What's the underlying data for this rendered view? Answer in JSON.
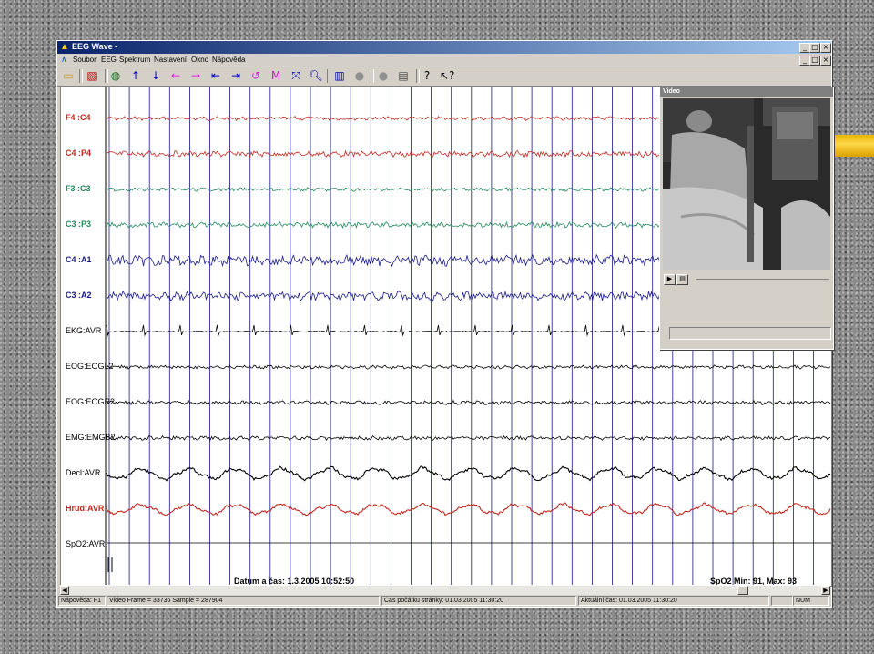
{
  "window": {
    "title": "EEG Wave -",
    "controls": [
      "_",
      "□",
      "×"
    ],
    "mdi_controls": [
      "_",
      "□",
      "×"
    ]
  },
  "menu": [
    "Soubor",
    "EEG",
    "Spektrum",
    "Nastavení",
    "Okno",
    "Nápověda"
  ],
  "toolbar_icons": [
    {
      "name": "open-icon",
      "glyph": "▭",
      "color": "#c89b2c"
    },
    {
      "name": "montage-icon",
      "glyph": "▧",
      "color": "#c00000"
    },
    {
      "name": "filter-icon",
      "glyph": "◍",
      "color": "#207020"
    },
    {
      "name": "arrow-up-icon",
      "glyph": "↑",
      "color": "#0000c0"
    },
    {
      "name": "arrow-down-icon",
      "glyph": "↓",
      "color": "#0000c0"
    },
    {
      "name": "arrow-left-icon",
      "glyph": "←",
      "color": "#e020e0"
    },
    {
      "name": "arrow-right-icon",
      "glyph": "→",
      "color": "#e020e0"
    },
    {
      "name": "first-page-icon",
      "glyph": "⇤",
      "color": "#0000c0"
    },
    {
      "name": "last-page-icon",
      "glyph": "⇥",
      "color": "#0000c0"
    },
    {
      "name": "loop-icon",
      "glyph": "↺",
      "color": "#e020e0"
    },
    {
      "name": "marker-icon",
      "glyph": "M",
      "color": "#c020c0"
    },
    {
      "name": "measure-icon",
      "glyph": "⤧",
      "color": "#0000c0"
    },
    {
      "name": "zoom-icon",
      "glyph": "🔍︎",
      "color": "#0000a0"
    },
    {
      "name": "spectrum-icon",
      "glyph": "▥",
      "color": "#0000a0"
    },
    {
      "name": "record-icon",
      "glyph": "●",
      "color": "#909090"
    },
    {
      "name": "stop-icon",
      "glyph": "●",
      "color": "#909090"
    },
    {
      "name": "print-icon",
      "glyph": "▤",
      "color": "#404040"
    },
    {
      "name": "help-icon",
      "glyph": "?",
      "color": "#000000"
    },
    {
      "name": "context-help-icon",
      "glyph": "↖?",
      "color": "#000000"
    }
  ],
  "channels": [
    {
      "label": "F4  :C4",
      "color": "#c0281e",
      "amp": 2.2,
      "style": "eeg"
    },
    {
      "label": "C4  :P4",
      "color": "#c0281e",
      "amp": 3.2,
      "style": "eeg"
    },
    {
      "label": "F3  :C3",
      "color": "#1e8a5a",
      "amp": 2.0,
      "style": "eeg"
    },
    {
      "label": "C3  :P3",
      "color": "#1e8a5a",
      "amp": 3.0,
      "style": "eeg"
    },
    {
      "label": "C4  :A1",
      "color": "#1a1a8c",
      "amp": 6.0,
      "style": "eeg"
    },
    {
      "label": "C3  :A2",
      "color": "#1a1a8c",
      "amp": 5.0,
      "style": "eeg"
    },
    {
      "label": "EKG:AVR",
      "color": "#000000",
      "amp": 1.0,
      "style": "ekg"
    },
    {
      "label": "EOG:EOGL2",
      "color": "#000000",
      "amp": 2.0,
      "style": "eeg"
    },
    {
      "label": "EOG:EOGR2",
      "color": "#000000",
      "amp": 2.2,
      "style": "eeg"
    },
    {
      "label": "EMG:EMGB2",
      "color": "#000000",
      "amp": 2.2,
      "style": "eeg"
    },
    {
      "label": "Decl:AVR",
      "color": "#000000",
      "amp": 9.0,
      "style": "resp"
    },
    {
      "label": "Hrud:AVR",
      "color": "#c0281e",
      "amp": 8.0,
      "style": "resp"
    },
    {
      "label": "SpO2:AVR",
      "color": "#000000",
      "amp": 0,
      "style": "flat"
    }
  ],
  "footer": {
    "datetime": "Datum a čas: 1.3.2005 10:52:50",
    "spo2": "SpO2 Min: 91, Max: 93"
  },
  "status": {
    "help": "Nápověda: F1",
    "frame": "Video Frame = 33736  Sample = 287904",
    "page_start": "Čas počátku stránky: 01.03.2005 11:30:20",
    "current": "Aktuální čas: 01.03.2005 11:30:20",
    "num": "NUM"
  },
  "video": {
    "title": "Video",
    "play": "▶",
    "snapshot": "▤"
  },
  "colors": {
    "gridline": "#1a1a8c"
  }
}
